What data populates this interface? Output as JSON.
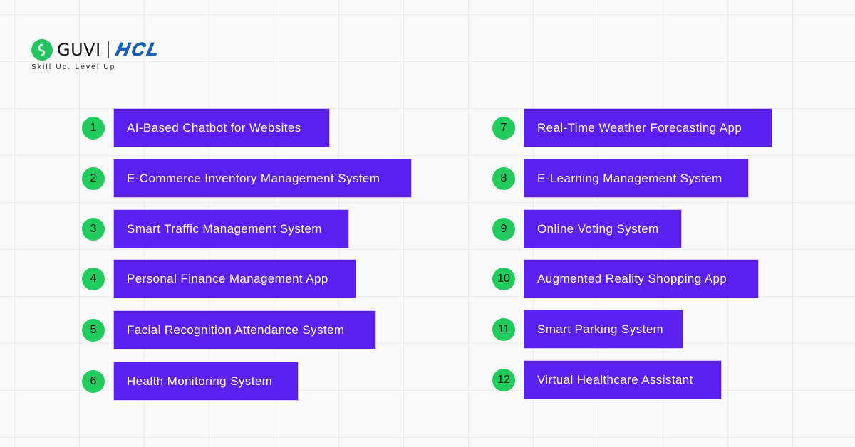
{
  "brand": {
    "guvi": "GUVI",
    "partner": "HCL",
    "tagline": "Skill Up. Level Up"
  },
  "colors": {
    "accent_purple": "#5b1ff0",
    "badge_green": "#1fcc5c",
    "hcl_blue": "#1b5fb4"
  },
  "items": [
    {
      "number": "1",
      "label": "AI-Based Chatbot for Websites"
    },
    {
      "number": "2",
      "label": "E-Commerce Inventory Management System"
    },
    {
      "number": "3",
      "label": "Smart Traffic Management System"
    },
    {
      "number": "4",
      "label": "Personal Finance Management App"
    },
    {
      "number": "5",
      "label": "Facial Recognition Attendance System"
    },
    {
      "number": "6",
      "label": "Health Monitoring System"
    },
    {
      "number": "7",
      "label": "Real-Time Weather Forecasting App"
    },
    {
      "number": "8",
      "label": "E-Learning Management System"
    },
    {
      "number": "9",
      "label": "Online Voting System"
    },
    {
      "number": "10",
      "label": "Augmented Reality Shopping App"
    },
    {
      "number": "11",
      "label": "Smart Parking System"
    },
    {
      "number": "12",
      "label": "Virtual Healthcare Assistant"
    }
  ]
}
